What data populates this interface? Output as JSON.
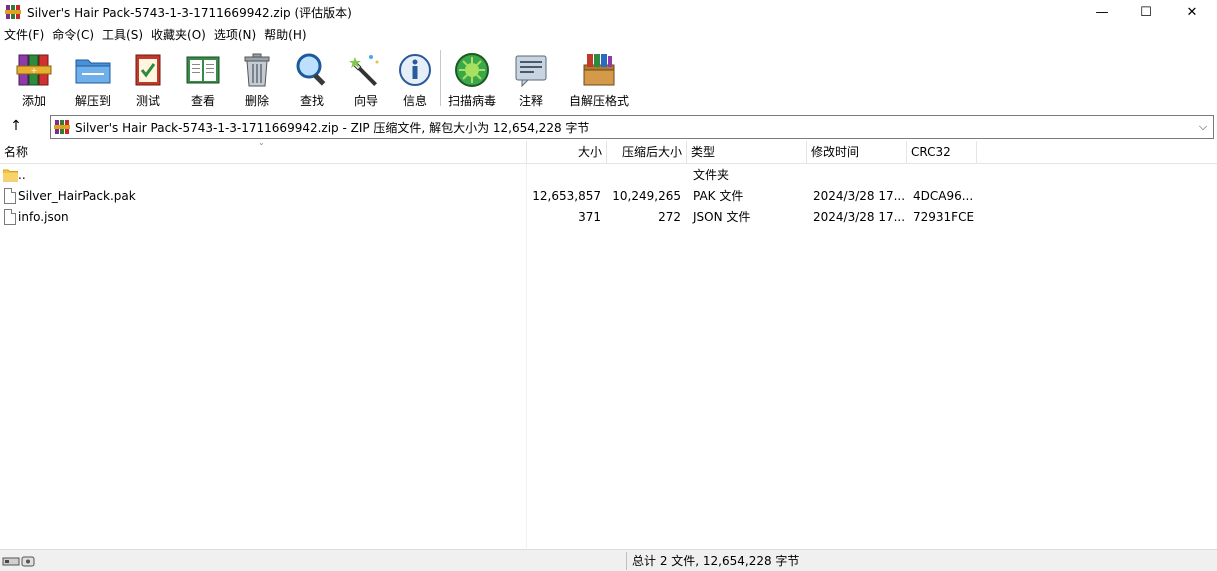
{
  "window": {
    "title": "Silver's Hair Pack-5743-1-3-1711669942.zip (评估版本)",
    "min_glyph": "—",
    "max_glyph": "☐",
    "close_glyph": "✕"
  },
  "menu": [
    "文件(F)",
    "命令(C)",
    "工具(S)",
    "收藏夹(O)",
    "选项(N)",
    "帮助(H)"
  ],
  "toolbar": [
    {
      "label": "添加",
      "icon": "add-archive-icon"
    },
    {
      "label": "解压到",
      "icon": "extract-to-icon"
    },
    {
      "label": "测试",
      "icon": "test-icon"
    },
    {
      "label": "查看",
      "icon": "view-icon"
    },
    {
      "label": "删除",
      "icon": "delete-icon"
    },
    {
      "label": "查找",
      "icon": "find-icon"
    },
    {
      "label": "向导",
      "icon": "wizard-icon"
    },
    {
      "label": "信息",
      "icon": "info-icon"
    },
    {
      "label": "扫描病毒",
      "icon": "virus-scan-icon"
    },
    {
      "label": "注释",
      "icon": "comment-icon"
    },
    {
      "label": "自解压格式",
      "icon": "sfx-icon"
    }
  ],
  "address": {
    "up_glyph": "↑",
    "text": "Silver's Hair Pack-5743-1-3-1711669942.zip - ZIP 压缩文件, 解包大小为 12,654,228 字节",
    "dropdown_glyph": "⌵"
  },
  "columns": {
    "name": "名称",
    "size": "大小",
    "packed": "压缩后大小",
    "type": "类型",
    "modified": "修改时间",
    "crc": "CRC32"
  },
  "rows": [
    {
      "name": "..",
      "size": "",
      "packed": "",
      "type": "文件夹",
      "modified": "",
      "crc": "",
      "kind": "folder"
    },
    {
      "name": "Silver_HairPack.pak",
      "size": "12,653,857",
      "packed": "10,249,265",
      "type": "PAK 文件",
      "modified": "2024/3/28 17...",
      "crc": "4DCA96...",
      "kind": "file"
    },
    {
      "name": "info.json",
      "size": "371",
      "packed": "272",
      "type": "JSON 文件",
      "modified": "2024/3/28 17...",
      "crc": "72931FCE",
      "kind": "file"
    }
  ],
  "status": {
    "summary": "总计 2 文件, 12,654,228 字节"
  },
  "colors": {
    "folder": "#f5c342",
    "accent": "#0078d7"
  }
}
